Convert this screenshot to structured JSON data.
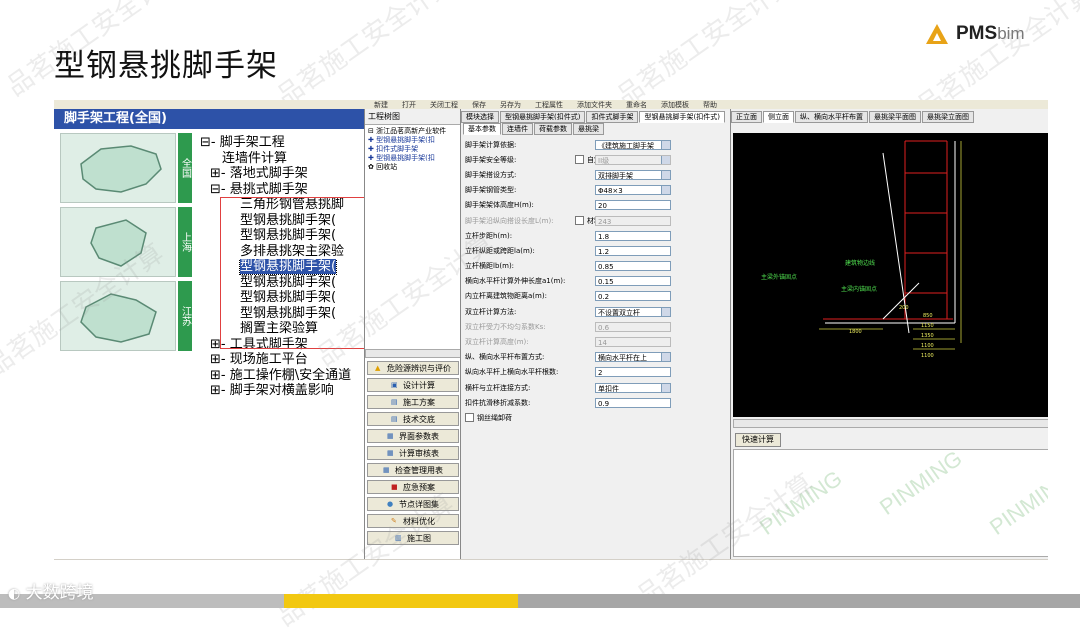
{
  "slide": {
    "title": "型钢悬挑脚手架",
    "brand": "PMS",
    "brand_suffix": "bim",
    "bottom_label": "大数跨境",
    "watermark": "品茗施工安全计算"
  },
  "left_panel": {
    "header": "脚手架工程(全国)",
    "map_labels": [
      "全国",
      "上海",
      "江苏"
    ],
    "tree": [
      {
        "text": "⊟- 脚手架工程",
        "indent": 0
      },
      {
        "text": "连墙件计算",
        "indent": 2
      },
      {
        "text": "⊞- 落地式脚手架",
        "indent": 1
      },
      {
        "text": "⊟- 悬挑式脚手架",
        "indent": 1
      },
      {
        "text": "三角形钢管悬挑脚",
        "indent": 3
      },
      {
        "text": "型钢悬挑脚手架(",
        "indent": 3
      },
      {
        "text": "型钢悬挑脚手架(",
        "indent": 3
      },
      {
        "text": "多排悬挑架主梁验",
        "indent": 3
      },
      {
        "text": "型钢悬挑脚手架(",
        "indent": 3,
        "selected": true
      },
      {
        "text": "型钢悬挑脚手架(",
        "indent": 3
      },
      {
        "text": "型钢悬挑脚手架(",
        "indent": 3
      },
      {
        "text": "型钢悬挑脚手架(",
        "indent": 3
      },
      {
        "text": "搁置主梁验算",
        "indent": 3
      },
      {
        "text": "⊞- 工具式脚手架",
        "indent": 1
      },
      {
        "text": "⊞- 现场施工平台",
        "indent": 1
      },
      {
        "text": "⊞- 施工操作棚\\安全通道",
        "indent": 1
      },
      {
        "text": "⊞- 脚手架对横盖影响",
        "indent": 1
      }
    ]
  },
  "menu_strip": [
    "新建",
    "打开",
    "关闭工程",
    "保存",
    "另存为",
    "工程属性",
    "添加文件夹",
    "重命名",
    "添加模板",
    "帮助"
  ],
  "middle_panel": {
    "title": "工程树图",
    "mini_tree": [
      "⊟ 浙江品茗高新产业软件",
      "  ✚ 型钢悬挑脚手架(扣",
      "  ✚ 扣件式脚手架",
      "  ✚ 型钢悬挑脚手架(扣",
      "✿ 回收站"
    ],
    "buttons": [
      "危险源辨识与评价",
      "设计计算",
      "施工方案",
      "技术交底",
      "界面参数表",
      "计算审核表",
      "检查管理用表",
      "应急预案",
      "节点详图集",
      "材料优化",
      "施工图"
    ]
  },
  "form_panel": {
    "top_tabs": [
      "模块选择",
      "型钢悬挑脚手架(扣件式)",
      "扣件式脚手架",
      "型钢悬挑脚手架(扣件式)"
    ],
    "sub_tabs": [
      "基本参数",
      "连墙件",
      "荷载参数",
      "悬挑梁"
    ],
    "rows": [
      {
        "label": "脚手架计算依据:",
        "value": "《建筑施工脚手架",
        "type": "dropdown"
      },
      {
        "label": "脚手架安全等级:",
        "value": "II级",
        "type": "dropdown-disabled",
        "check": "自定义"
      },
      {
        "label": "脚手架搭设方式:",
        "value": "双排脚手架",
        "type": "dropdown"
      },
      {
        "label": "脚手架钢管类型:",
        "value": "Φ48×3",
        "type": "dropdown"
      },
      {
        "label": "脚手架架体高度H(m):",
        "value": "20",
        "type": "input"
      },
      {
        "label": "脚手架沿纵向搭设长度L(m):",
        "value": "243",
        "type": "input-disabled",
        "check": "材料用量",
        "disabled": true
      },
      {
        "label": "立杆步距h(m):",
        "value": "1.8",
        "type": "input"
      },
      {
        "label": "立杆纵距或跨距la(m):",
        "value": "1.2",
        "type": "input"
      },
      {
        "label": "立杆横距lb(m):",
        "value": "0.85",
        "type": "input"
      },
      {
        "label": "横向水平杆计算外伸长度a1(m):",
        "value": "0.15",
        "type": "input"
      },
      {
        "label": "内立杆离建筑物距离a(m):",
        "value": "0.2",
        "type": "input"
      },
      {
        "label": "双立杆计算方法:",
        "value": "不设置双立杆",
        "type": "dropdown"
      },
      {
        "label": "双立杆受力不均匀系数Ks:",
        "value": "0.6",
        "type": "input-disabled",
        "disabled": true
      },
      {
        "label": "双立杆计算高度(m):",
        "value": "14",
        "type": "input-disabled",
        "disabled": true
      },
      {
        "label": "纵、横向水平杆布置方式:",
        "value": "横向水平杆在上",
        "type": "dropdown"
      },
      {
        "label": "纵向水平杆上横向水平杆根数:",
        "value": "2",
        "type": "input"
      },
      {
        "label": "横杆与立杆连接方式:",
        "value": "单扣件",
        "type": "dropdown"
      },
      {
        "label": "扣件抗滑移折减系数:",
        "value": "0.9",
        "type": "input"
      }
    ],
    "bottom_check": "钢丝绳卸荷"
  },
  "drawing_panel": {
    "tabs": [
      "正立面",
      "侧立面",
      "纵、横向水平杆布置",
      "悬挑梁平面图",
      "悬挑梁立面图"
    ],
    "annotations": [
      "主梁外锚固点",
      "主梁内锚固点",
      "建筑物边线"
    ],
    "dims": [
      "1150",
      "1350",
      "1100",
      "1100",
      "200",
      "850",
      "1800"
    ],
    "calc_button": "快速计算",
    "watermark": "PINMING"
  }
}
